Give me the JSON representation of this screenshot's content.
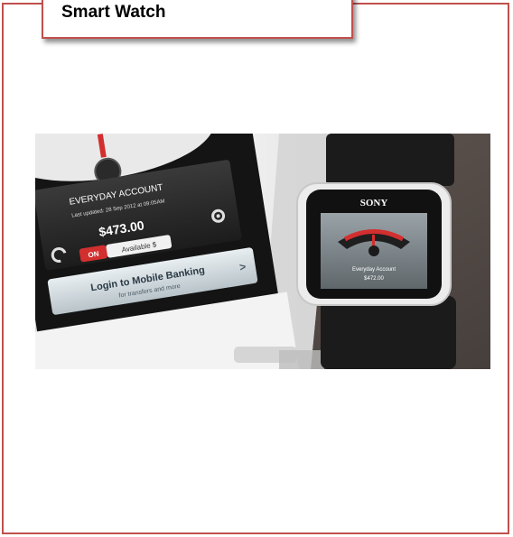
{
  "slide": {
    "title": "Smart Watch"
  },
  "photo": {
    "phone": {
      "account_title": "EVERYDAY ACCOUNT",
      "last_updated": "Last updated: 28 Sep 2012 at 09:05AM",
      "balance": "$473.00",
      "toggle_on": "ON",
      "available": "Available $",
      "login_title": "Login to Mobile Banking",
      "login_subtitle": "for transfers and more",
      "chevron": ">"
    },
    "watch": {
      "brand": "SONY",
      "account": "Everyday Account",
      "balance": "$472.00"
    }
  },
  "colors": {
    "frame_border": "#c0504d",
    "toggle_red": "#d32f2f",
    "watch_frame": "#f2f2f2"
  }
}
